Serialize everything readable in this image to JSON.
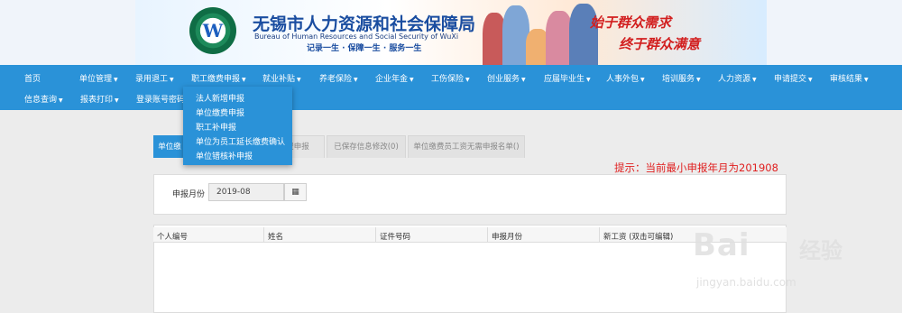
{
  "banner": {
    "title_cn": "无锡市人力资源和社会保障局",
    "title_en": "Bureau of Human Resources and Social Security of WuXi",
    "slogan": "记录一生 · 保障一生 · 服务一生",
    "slogan_right_1": "始于群众需求",
    "slogan_right_2": "终于群众满意"
  },
  "nav": {
    "row1": [
      {
        "label": "首页"
      },
      {
        "label": "单位管理"
      },
      {
        "label": "录用退工"
      },
      {
        "label": "职工缴费申报"
      },
      {
        "label": "就业补贴"
      },
      {
        "label": "养老保险"
      },
      {
        "label": "企业年金"
      },
      {
        "label": "工伤保险"
      },
      {
        "label": "创业服务"
      },
      {
        "label": "应届毕业生"
      },
      {
        "label": "人事外包"
      },
      {
        "label": "培训服务"
      },
      {
        "label": "人力资源"
      },
      {
        "label": "申请提交"
      },
      {
        "label": "审核结果"
      }
    ],
    "row2": [
      {
        "label": "信息查询"
      },
      {
        "label": "报表打印"
      },
      {
        "label": "登录账号密码"
      }
    ]
  },
  "dropdown": {
    "items": [
      "法人新增申报",
      "单位缴费申报",
      "职工补申报",
      "单位为员工延长缴费确认",
      "单位错核补申报"
    ]
  },
  "tabs": [
    "单位缴",
    "费申报",
    "已保存信息修改(0)",
    "单位缴费员工资无需申报名单()"
  ],
  "tip": "提示：当前最小申报年月为201908",
  "filter": {
    "label": "申报月份",
    "value": "2019-08",
    "icon": "calendar-icon"
  },
  "table": {
    "columns": [
      "个人编号",
      "姓名",
      "证件号码",
      "申报月份",
      "新工资 (双击可编辑)"
    ]
  },
  "watermark": {
    "brand": "Bai",
    "brand2": "经验",
    "url": "jingyan.baidu.com"
  },
  "colors": {
    "nav_bg": "#2a92d8",
    "tip": "#e02020",
    "title": "#1a4da0"
  }
}
